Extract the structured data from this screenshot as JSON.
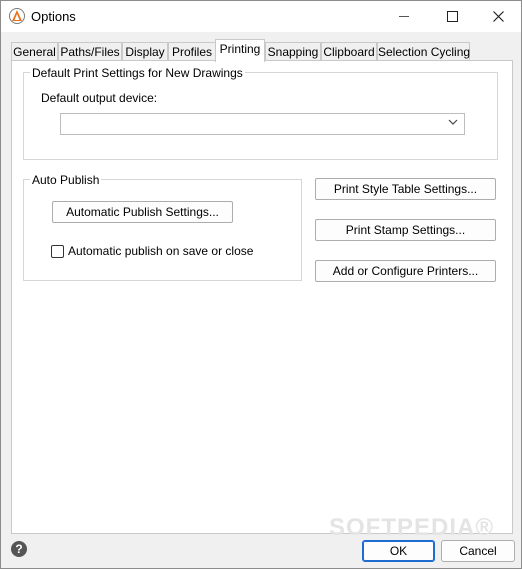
{
  "window": {
    "title": "Options",
    "controls": {
      "minimize": "—",
      "maximize": "☐",
      "close": "✕"
    }
  },
  "tabs": [
    {
      "label": "General"
    },
    {
      "label": "Paths/Files"
    },
    {
      "label": "Display"
    },
    {
      "label": "Profiles"
    },
    {
      "label": "Printing",
      "active": true
    },
    {
      "label": "Snapping"
    },
    {
      "label": "Clipboard"
    },
    {
      "label": "Selection Cycling"
    }
  ],
  "default_print": {
    "group_label": "Default Print Settings for New Drawings",
    "device_label": "Default output device:",
    "device_value": ""
  },
  "auto_publish": {
    "group_label": "Auto Publish",
    "settings_button": "Automatic Publish Settings...",
    "checkbox_label": "Automatic publish on save or close",
    "checked": false
  },
  "right_buttons": {
    "print_style": "Print Style Table Settings...",
    "print_stamp": "Print Stamp Settings...",
    "printers": "Add or Configure Printers..."
  },
  "footer": {
    "help": "?",
    "ok": "OK",
    "cancel": "Cancel"
  },
  "watermark": "SOFTPEDIA®"
}
